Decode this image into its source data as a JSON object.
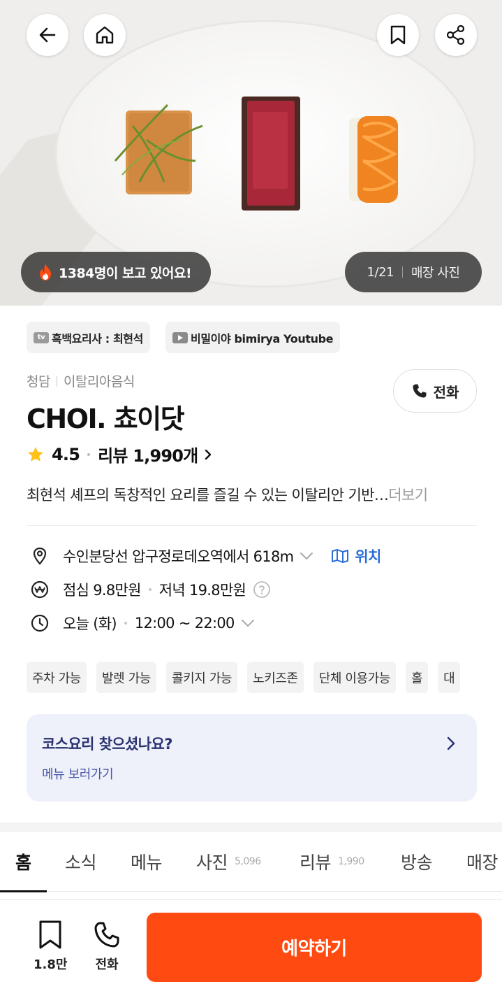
{
  "hero": {
    "viewers_text": "1384명이 보고 있어요!",
    "photo_counter": "1/21",
    "photo_label": "매장 사진"
  },
  "chips": [
    {
      "icon": "tv-icon",
      "label": "흑백요리사 : 최현석"
    },
    {
      "icon": "youtube-icon",
      "label": "비밀이야 bimirya Youtube"
    }
  ],
  "restaurant": {
    "area": "청담",
    "cuisine": "이탈리아음식",
    "name": "CHOI. 쵸이닷",
    "call_label": "전화",
    "rating": "4.5",
    "reviews_label": "리뷰 1,990개",
    "description": "최현석 셰프의 독창적인 요리를 즐길 수 있는 이탈리안 기반…",
    "more_label": "더보기"
  },
  "info": {
    "location": "수인분당선 압구정로데오역에서 618m",
    "location_link": "위치",
    "lunch_price": "점심 9.8만원",
    "dinner_price": "저녁 19.8만원",
    "day": "오늘 (화)",
    "hours": "12:00 ~ 22:00"
  },
  "tags": [
    "주차 가능",
    "발렛 가능",
    "콜키지 가능",
    "노키즈존",
    "단체 이용가능",
    "홀",
    "대"
  ],
  "course_banner": {
    "title": "코스요리 찾으셨나요?",
    "subtitle": "메뉴 보러가기"
  },
  "tabs": [
    {
      "label": "홈",
      "count": ""
    },
    {
      "label": "소식",
      "count": ""
    },
    {
      "label": "메뉴",
      "count": ""
    },
    {
      "label": "사진",
      "count": "5,096"
    },
    {
      "label": "리뷰",
      "count": "1,990"
    },
    {
      "label": "방송",
      "count": ""
    },
    {
      "label": "매장",
      "count": ""
    }
  ],
  "bottom_bar": {
    "save_count": "1.8만",
    "call_label": "전화",
    "reserve_label": "예약하기"
  },
  "colors": {
    "accent": "#ff4b12",
    "link": "#2b6fd6",
    "banner_bg": "#eef0fa"
  }
}
